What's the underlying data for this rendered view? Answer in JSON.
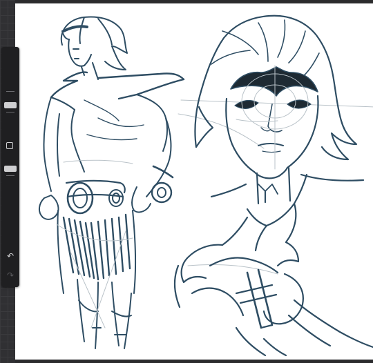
{
  "app": {
    "background_color": "#2b2b2d",
    "canvas_color": "#ffffff",
    "ink_color": "#2e4d63",
    "sketch_color": "#b9c2c8"
  },
  "sidebar": {
    "brush_size_slider": {
      "icon": "slider-handle",
      "level": 0.15
    },
    "modify_button": {
      "icon": "square-icon"
    },
    "opacity_slider": {
      "icon": "slider-handle",
      "level": 0.1
    },
    "undo_button": {
      "icon": "undo-icon",
      "glyph": "↶"
    },
    "redo_button": {
      "icon": "redo-icon",
      "glyph": "↷",
      "enabled": false
    }
  },
  "artwork": {
    "subject": "character-sketch",
    "figures": [
      "full-body-figure",
      "head-closeup",
      "hand-holding-hilt"
    ]
  }
}
